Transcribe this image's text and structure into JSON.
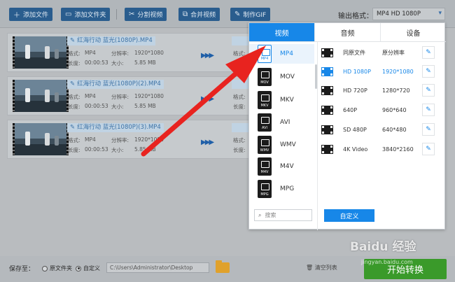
{
  "toolbar": {
    "add_file": "添加文件",
    "add_folder": "添加文件夹",
    "split_video": "分割视频",
    "merge_video": "合并视频",
    "make_gif": "制作GIF",
    "output_format_label": "输出格式：",
    "output_format_value": "MP4 HD 1080P"
  },
  "files": [
    {
      "name": "红海行动 蓝光(1080P).MP4",
      "format_label": "格式:",
      "format": "MP4",
      "res_label": "分辨率:",
      "resolution": "1920*1080",
      "dur_label": "长度:",
      "duration": "00:00:53",
      "size_label": "大小:",
      "size": "5.85 MB",
      "r_format_label": "格式:",
      "r_dur_label": "长度:"
    },
    {
      "name": "红海行动 蓝光(1080P)(2).MP4",
      "format_label": "格式:",
      "format": "MP4",
      "res_label": "分辨率:",
      "resolution": "1920*1080",
      "dur_label": "长度:",
      "duration": "00:00:53",
      "size_label": "大小:",
      "size": "5.85 MB",
      "r_format_label": "格式:",
      "r_dur_label": "长度:"
    },
    {
      "name": "红海行动 蓝光(1080P)(3).MP4",
      "format_label": "格式:",
      "format": "MP4",
      "res_label": "分辨率:",
      "resolution": "1920*1080",
      "dur_label": "长度:",
      "duration": "00:00:53",
      "size_label": "大小:",
      "size": "5.85 MB",
      "r_format_label": "格式:",
      "r_dur_label": "长度:"
    }
  ],
  "popup": {
    "tabs": [
      "视频",
      "音频",
      "设备"
    ],
    "formats": [
      "MP4",
      "MOV",
      "MKV",
      "AVI",
      "WMV",
      "M4V",
      "MPG"
    ],
    "selected_format": "MP4",
    "qualities": [
      {
        "name": "同原文件",
        "res": "原分辨率"
      },
      {
        "name": "HD 1080P",
        "res": "1920*1080"
      },
      {
        "name": "HD 720P",
        "res": "1280*720"
      },
      {
        "name": "640P",
        "res": "960*640"
      },
      {
        "name": "SD 480P",
        "res": "640*480"
      },
      {
        "name": "4K Video",
        "res": "3840*2160"
      }
    ],
    "selected_quality": "HD 1080P",
    "search_placeholder": "搜索",
    "custom_button": "自定义"
  },
  "bottom": {
    "save_to": "保存至：",
    "opt_source": "原文件夹",
    "opt_custom": "自定义",
    "path": "C:\\Users\\Administrator\\Desktop",
    "clear_list": "清空列表",
    "start": "开始转换"
  },
  "watermark": {
    "text": "Baidu 经验",
    "url": "jingyan.baidu.com"
  },
  "colors": {
    "accent": "#1787e8",
    "start": "#3a9a2a",
    "toolbar_btn": "#2a5d8e",
    "annotation_arrow": "#e8231f"
  }
}
